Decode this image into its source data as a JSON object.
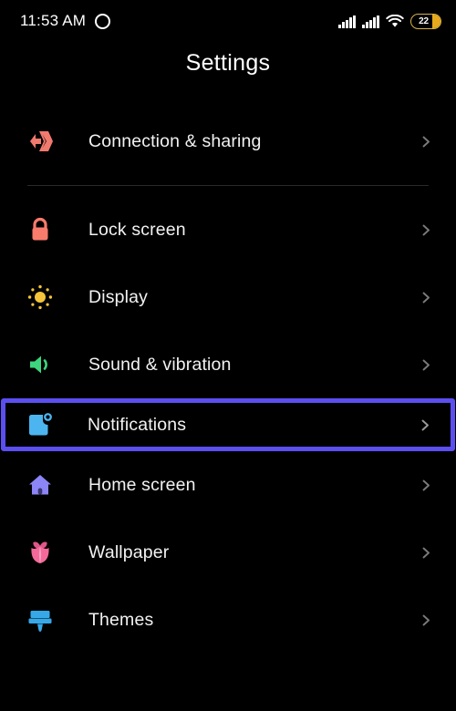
{
  "status_bar": {
    "time": "11:53 AM",
    "left_icon": "circle-ring-icon",
    "signal_1": "signal-bars-icon",
    "signal_2": "signal-bars-icon",
    "wifi": "wifi-icon",
    "battery_percent": "22",
    "battery_icon": "battery-icon",
    "battery_color": "#e8a91d"
  },
  "header": {
    "title": "Settings"
  },
  "selection": {
    "selected_item": "Notifications",
    "highlight_color": "#5b4ff0"
  },
  "groups": [
    {
      "items": [
        {
          "label": "Connection & sharing",
          "icon": "connection-sharing-icon",
          "color": "#f07a6e",
          "selected": false,
          "chevron": "chevron-right-icon"
        }
      ]
    },
    {
      "items": [
        {
          "label": "Lock screen",
          "icon": "lock-icon",
          "color": "#f97b6c",
          "selected": false,
          "chevron": "chevron-right-icon"
        },
        {
          "label": "Display",
          "icon": "sun-brightness-icon",
          "color": "#f5c43a",
          "selected": false,
          "chevron": "chevron-right-icon"
        },
        {
          "label": "Sound & vibration",
          "icon": "speaker-volume-icon",
          "color": "#3dd67f",
          "selected": false,
          "chevron": "chevron-right-icon"
        },
        {
          "label": "Notifications",
          "icon": "notification-badge-icon",
          "color": "#4cb5f0",
          "selected": true,
          "chevron": "chevron-right-icon"
        },
        {
          "label": "Home screen",
          "icon": "house-icon",
          "color": "#8b85f5",
          "selected": false,
          "chevron": "chevron-right-icon"
        },
        {
          "label": "Wallpaper",
          "icon": "flower-tulip-icon",
          "color": "#f36a9a",
          "selected": false,
          "chevron": "chevron-right-icon"
        },
        {
          "label": "Themes",
          "icon": "paint-brush-icon",
          "color": "#36a8e8",
          "selected": false,
          "chevron": "chevron-right-icon"
        }
      ]
    }
  ]
}
